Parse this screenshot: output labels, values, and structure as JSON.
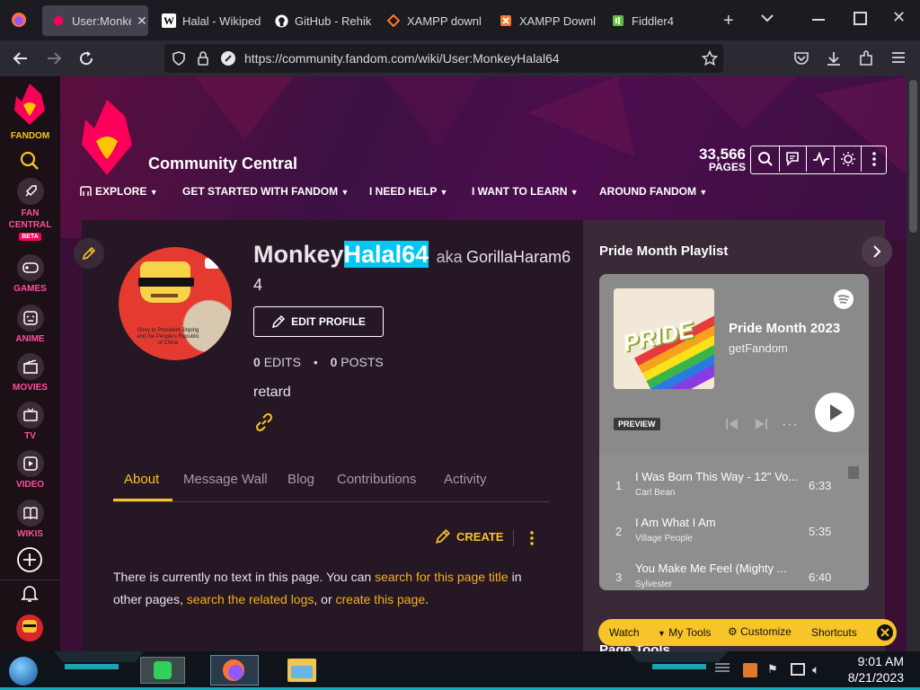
{
  "browser": {
    "tabs": [
      {
        "label": "User:Monke",
        "active": true,
        "icon": "fandom-icon"
      },
      {
        "label": "Halal - Wikiped",
        "icon": "wikipedia-icon"
      },
      {
        "label": "GitHub - Rehik",
        "icon": "github-icon"
      },
      {
        "label": "XAMPP downl",
        "icon": "xampp-icon"
      },
      {
        "label": "XAMPP Downl",
        "icon": "xampp-icon"
      },
      {
        "label": "Fiddler4",
        "icon": "fiddler-icon"
      }
    ],
    "url": "https://community.fandom.com/wiki/User:MonkeyHalal64"
  },
  "rail": {
    "brand": "FANDOM",
    "items": [
      {
        "label": "FAN CENTRAL",
        "badge": "BETA",
        "icon": "rocket-icon"
      },
      {
        "label": "GAMES",
        "icon": "gamepad-icon"
      },
      {
        "label": "ANIME",
        "icon": "anime-icon"
      },
      {
        "label": "MOVIES",
        "icon": "clapper-icon"
      },
      {
        "label": "TV",
        "icon": "tv-icon"
      },
      {
        "label": "VIDEO",
        "icon": "play-icon"
      },
      {
        "label": "WIKIS",
        "icon": "book-icon"
      }
    ]
  },
  "wiki": {
    "name": "Community Central",
    "pages_count": "33,566",
    "pages_label": "PAGES",
    "nav": [
      "EXPLORE",
      "GET STARTED WITH FANDOM",
      "I NEED HELP",
      "I WANT TO LEARN",
      "AROUND FANDOM"
    ]
  },
  "profile": {
    "name_prefix": "Monkey",
    "name_highlight": "Halal64",
    "aka": "aka",
    "alias_line1": "GorillaHaram6",
    "alias_line2": "4",
    "edit_button": "EDIT PROFILE",
    "edits_count": "0",
    "edits_label": "EDITS",
    "posts_count": "0",
    "posts_label": "POSTS",
    "bio": "retard",
    "avatar_caption": "Glory to President Jinping and the People's Republic of China"
  },
  "profile_tabs": [
    "About",
    "Message Wall",
    "Blog",
    "Contributions",
    "Activity"
  ],
  "page_actions": {
    "create": "CREATE"
  },
  "body_text": {
    "p1": "There is currently no text in this page. You can",
    "link1": "search for this page title",
    "p2": "in",
    "p3": "other pages,",
    "link2": "search the related logs",
    "p4": ", or",
    "link3": "create this page",
    "p5": "."
  },
  "sidebar": {
    "title": "Pride Month Playlist",
    "playlist_title": "Pride Month 2023",
    "playlist_owner": "getFandom",
    "preview_label": "PREVIEW",
    "cover_text": "PRIDE",
    "tracks": [
      {
        "num": "1",
        "title": "I Was Born This Way - 12\" Vo...",
        "artist": "Carl Bean",
        "duration": "6:33"
      },
      {
        "num": "2",
        "title": "I Am What I Am",
        "artist": "Village People",
        "duration": "5:35"
      },
      {
        "num": "3",
        "title": "You Make Me Feel (Mighty ...",
        "artist": "Sylvester",
        "duration": "6:40"
      }
    ],
    "page_tools_partial": "Page Tools"
  },
  "toolbar": {
    "watch": "Watch",
    "my_tools": "My Tools",
    "customize": "Customize",
    "shortcuts": "Shortcuts"
  },
  "taskbar": {
    "time": "9:01 AM",
    "date": "8/21/2023"
  },
  "colors": {
    "fandom_pink": "#fa005a",
    "link_gold": "#f4b11c",
    "highlight_cyan": "#00c8f0",
    "toolbar_yellow": "#f7c42a"
  }
}
